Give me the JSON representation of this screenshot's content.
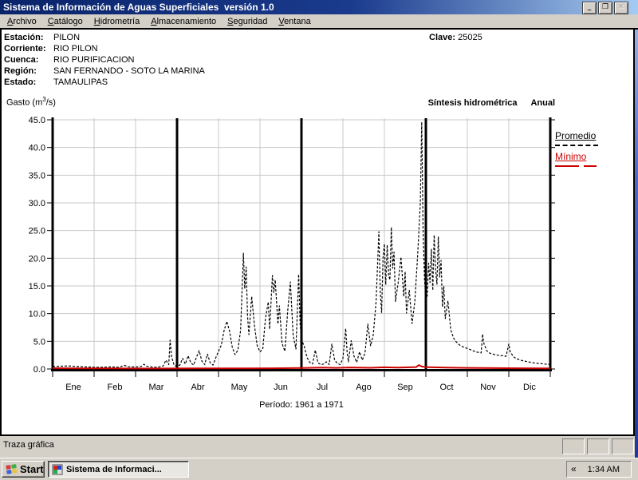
{
  "window": {
    "title": "Sistema de Información de Aguas Superficiales  versión 1.0",
    "minimize_glyph": "_",
    "restore_glyph": "❐",
    "close_glyph": "✕"
  },
  "menu": {
    "items": [
      "Archivo",
      "Catálogo",
      "Hidrometría",
      "Almacenamiento",
      "Seguridad",
      "Ventana"
    ]
  },
  "station": {
    "rows": [
      {
        "label": "Estación:",
        "value": "PILON"
      },
      {
        "label": "Corriente:",
        "value": "RIO PILON"
      },
      {
        "label": "Cuenca:",
        "value": "RIO PURIFICACION"
      },
      {
        "label": "Región:",
        "value": "SAN FERNANDO - SOTO LA MARINA"
      },
      {
        "label": "Estado:",
        "value": "TAMAULIPAS"
      }
    ],
    "clave_label": "Clave:",
    "clave_value": "25025"
  },
  "chart_header": {
    "unit_prefix": "Gasto (m",
    "unit_sup": "3",
    "unit_suffix": "/s)",
    "title_main": "Síntesis hidrométrica",
    "title_sub": "Anual"
  },
  "legend": {
    "promedio": "Promedio",
    "minimo": "Mínimo"
  },
  "statusbar": {
    "text": "Traza gráfica"
  },
  "taskbar": {
    "start_label": "Start",
    "task_label": "Sistema de Informaci...",
    "tray_chevron": "«",
    "clock": "1:34 AM"
  },
  "colors": {
    "titlebar_left": "#0a246a",
    "titlebar_right": "#a6caf0",
    "chrome_gray": "#d4d0c8",
    "promedio": "#000000",
    "minimo": "#cc0000",
    "gridline": "#c9c9c9"
  },
  "chart_data": {
    "type": "line",
    "title": "Síntesis hidrométrica  Anual",
    "ylabel": "Gasto (m³/s)",
    "period_label": "Período: 1961 a 1971",
    "categories": [
      "Ene",
      "Feb",
      "Mar",
      "Abr",
      "May",
      "Jun",
      "Jul",
      "Ago",
      "Sep",
      "Oct",
      "Nov",
      "Dic"
    ],
    "ylim": [
      0,
      45
    ],
    "ytick_step": 5,
    "ytick_labels": [
      "0.0",
      "5.0",
      "10.0",
      "15.0",
      "20.0",
      "25.0",
      "30.0",
      "35.0",
      "40.0",
      "45.0"
    ],
    "x_units": "day of year, 30-day months, 0–360",
    "grid": true,
    "legend_position": "right",
    "quarter_divider_months": [
      3,
      6,
      9
    ],
    "series": [
      {
        "name": "Promedio",
        "color": "#000000",
        "style": "dashed",
        "width": 1.2,
        "points": [
          [
            0,
            0.45
          ],
          [
            6,
            0.5
          ],
          [
            12,
            0.55
          ],
          [
            18,
            0.45
          ],
          [
            24,
            0.38
          ],
          [
            30,
            0.32
          ],
          [
            36,
            0.3
          ],
          [
            42,
            0.38
          ],
          [
            48,
            0.3
          ],
          [
            52,
            0.65
          ],
          [
            55,
            0.4
          ],
          [
            60,
            0.35
          ],
          [
            64,
            0.45
          ],
          [
            66,
            0.85
          ],
          [
            68,
            0.5
          ],
          [
            72,
            0.35
          ],
          [
            76,
            0.32
          ],
          [
            80,
            0.55
          ],
          [
            82,
            1.6
          ],
          [
            84,
            0.8
          ],
          [
            85,
            5.2
          ],
          [
            86,
            2.2
          ],
          [
            88,
            0.6
          ],
          [
            90,
            0.5
          ],
          [
            92,
            0.7
          ],
          [
            94,
            1.9
          ],
          [
            96,
            0.9
          ],
          [
            98,
            2.4
          ],
          [
            100,
            1.1
          ],
          [
            102,
            0.7
          ],
          [
            104,
            2.1
          ],
          [
            106,
            3.3
          ],
          [
            108,
            1.4
          ],
          [
            110,
            0.8
          ],
          [
            112,
            2.7
          ],
          [
            114,
            1.1
          ],
          [
            116,
            0.7
          ],
          [
            118,
            2.0
          ],
          [
            120,
            3.2
          ],
          [
            122,
            4.3
          ],
          [
            124,
            6.9
          ],
          [
            126,
            8.6
          ],
          [
            128,
            6.8
          ],
          [
            130,
            3.9
          ],
          [
            132,
            2.6
          ],
          [
            134,
            3.4
          ],
          [
            136,
            7.0
          ],
          [
            138,
            20.9
          ],
          [
            139,
            14.5
          ],
          [
            140,
            18.4
          ],
          [
            141,
            9.5
          ],
          [
            142,
            6.2
          ],
          [
            144,
            13.1
          ],
          [
            146,
            7.8
          ],
          [
            148,
            4.2
          ],
          [
            150,
            3.1
          ],
          [
            152,
            3.6
          ],
          [
            154,
            9.2
          ],
          [
            156,
            12.1
          ],
          [
            157,
            7.2
          ],
          [
            159,
            16.9
          ],
          [
            160,
            13.8
          ],
          [
            161,
            16.1
          ],
          [
            163,
            8.1
          ],
          [
            164,
            11.4
          ],
          [
            166,
            4.6
          ],
          [
            168,
            3.2
          ],
          [
            170,
            10.4
          ],
          [
            172,
            15.7
          ],
          [
            174,
            6.1
          ],
          [
            176,
            3.6
          ],
          [
            178,
            17.1
          ],
          [
            179,
            8.2
          ],
          [
            180,
            5.3
          ],
          [
            182,
            4.1
          ],
          [
            184,
            2.1
          ],
          [
            186,
            1.2
          ],
          [
            188,
            0.9
          ],
          [
            190,
            3.4
          ],
          [
            192,
            1.1
          ],
          [
            194,
            0.8
          ],
          [
            196,
            0.9
          ],
          [
            198,
            1.3
          ],
          [
            200,
            0.8
          ],
          [
            202,
            4.5
          ],
          [
            204,
            1.6
          ],
          [
            206,
            1.0
          ],
          [
            208,
            0.8
          ],
          [
            210,
            1.9
          ],
          [
            212,
            7.3
          ],
          [
            213,
            3.1
          ],
          [
            214,
            1.3
          ],
          [
            216,
            5.1
          ],
          [
            218,
            2.3
          ],
          [
            220,
            1.2
          ],
          [
            222,
            3.1
          ],
          [
            224,
            1.6
          ],
          [
            226,
            2.9
          ],
          [
            228,
            8.1
          ],
          [
            230,
            4.2
          ],
          [
            232,
            6.2
          ],
          [
            234,
            12.2
          ],
          [
            236,
            24.8
          ],
          [
            237,
            14.0
          ],
          [
            238,
            10.2
          ],
          [
            239,
            20.1
          ],
          [
            240,
            22.6
          ],
          [
            241,
            15.2
          ],
          [
            242,
            22.4
          ],
          [
            243,
            17.0
          ],
          [
            244,
            16.1
          ],
          [
            245,
            25.6
          ],
          [
            246,
            18.2
          ],
          [
            247,
            21.1
          ],
          [
            248,
            12.2
          ],
          [
            250,
            15.6
          ],
          [
            252,
            20.2
          ],
          [
            254,
            13.1
          ],
          [
            255,
            17.6
          ],
          [
            256,
            10.1
          ],
          [
            258,
            14.2
          ],
          [
            260,
            8.2
          ],
          [
            262,
            12.1
          ],
          [
            264,
            20.3
          ],
          [
            266,
            30.2
          ],
          [
            267,
            44.6
          ],
          [
            268,
            25.2
          ],
          [
            269,
            16.2
          ],
          [
            270,
            12.6
          ],
          [
            271,
            13.2
          ],
          [
            272,
            19.1
          ],
          [
            273,
            15.6
          ],
          [
            274,
            21.6
          ],
          [
            275,
            14.2
          ],
          [
            276,
            24.2
          ],
          [
            277,
            18.1
          ],
          [
            278,
            15.3
          ],
          [
            279,
            23.9
          ],
          [
            280,
            16.6
          ],
          [
            281,
            19.6
          ],
          [
            282,
            11.2
          ],
          [
            283,
            14.9
          ],
          [
            284,
            9.1
          ],
          [
            286,
            12.3
          ],
          [
            288,
            7.1
          ],
          [
            290,
            5.6
          ],
          [
            292,
            4.9
          ],
          [
            294,
            4.4
          ],
          [
            296,
            4.1
          ],
          [
            298,
            3.9
          ],
          [
            300,
            3.7
          ],
          [
            302,
            3.5
          ],
          [
            304,
            3.3
          ],
          [
            306,
            3.1
          ],
          [
            308,
            3.0
          ],
          [
            310,
            2.9
          ],
          [
            311,
            6.3
          ],
          [
            312,
            4.6
          ],
          [
            314,
            3.3
          ],
          [
            316,
            2.9
          ],
          [
            318,
            2.7
          ],
          [
            320,
            2.6
          ],
          [
            322,
            2.5
          ],
          [
            325,
            2.4
          ],
          [
            328,
            2.3
          ],
          [
            330,
            4.5
          ],
          [
            331,
            3.1
          ],
          [
            332,
            2.7
          ],
          [
            334,
            2.1
          ],
          [
            336,
            1.8
          ],
          [
            340,
            1.5
          ],
          [
            344,
            1.3
          ],
          [
            348,
            1.1
          ],
          [
            352,
            1.0
          ],
          [
            356,
            0.9
          ],
          [
            360,
            0.8
          ]
        ]
      },
      {
        "name": "Mínimo",
        "color": "#cc0000",
        "style": "solid",
        "width": 2,
        "points": [
          [
            0,
            0.15
          ],
          [
            20,
            0.12
          ],
          [
            40,
            0.1
          ],
          [
            60,
            0.08
          ],
          [
            80,
            0.08
          ],
          [
            100,
            0.1
          ],
          [
            120,
            0.1
          ],
          [
            140,
            0.12
          ],
          [
            160,
            0.13
          ],
          [
            180,
            0.18
          ],
          [
            195,
            0.25
          ],
          [
            205,
            0.2
          ],
          [
            215,
            0.28
          ],
          [
            230,
            0.22
          ],
          [
            240,
            0.3
          ],
          [
            250,
            0.25
          ],
          [
            258,
            0.3
          ],
          [
            263,
            0.35
          ],
          [
            265,
            0.7
          ],
          [
            267,
            0.45
          ],
          [
            270,
            0.35
          ],
          [
            275,
            0.3
          ],
          [
            285,
            0.25
          ],
          [
            300,
            0.2
          ],
          [
            320,
            0.16
          ],
          [
            340,
            0.13
          ],
          [
            360,
            0.12
          ]
        ]
      }
    ]
  }
}
